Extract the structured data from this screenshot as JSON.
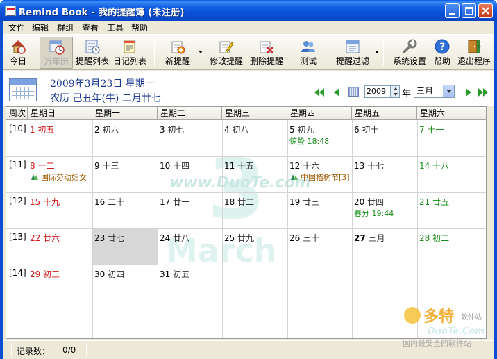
{
  "window": {
    "title": "Remind Book - 我的提醒簿 (未注册)"
  },
  "menu": [
    "文件",
    "编辑",
    "群组",
    "查看",
    "工具",
    "帮助"
  ],
  "toolbar": {
    "today": "今日",
    "year_calendar": "万年历",
    "reminder_list": "提醒列表",
    "diary_list": "日记列表",
    "new_reminder": "新提醒",
    "edit_reminder": "修改提醒",
    "delete_reminder": "删除提醒",
    "test": "测试",
    "reminder_filter": "提醒过滤",
    "system_settings": "系统设置",
    "help": "帮助",
    "exit": "退出程序"
  },
  "header": {
    "gregorian_date": "2009年3月23日 星期一",
    "lunar_date": "农历 己丑年(牛) 二月廿七",
    "year_value": "2009",
    "year_unit": "年",
    "month_value": "三月"
  },
  "calendar": {
    "columns": [
      "周次",
      "星期日",
      "星期一",
      "星期二",
      "星期三",
      "星期四",
      "星期五",
      "星期六"
    ],
    "weeks": [
      {
        "label": "[10]",
        "days": [
          {
            "num": "1",
            "lunar": "初五"
          },
          {
            "num": "2",
            "lunar": "初六"
          },
          {
            "num": "3",
            "lunar": "初七"
          },
          {
            "num": "4",
            "lunar": "初八"
          },
          {
            "num": "5",
            "lunar": "初九",
            "term": "惊蛰 18:48"
          },
          {
            "num": "6",
            "lunar": "初十"
          },
          {
            "num": "7",
            "lunar": "十一"
          }
        ]
      },
      {
        "label": "[11]",
        "days": [
          {
            "num": "8",
            "lunar": "十二",
            "event": "国际劳动妇女"
          },
          {
            "num": "9",
            "lunar": "十三"
          },
          {
            "num": "10",
            "lunar": "十四"
          },
          {
            "num": "11",
            "lunar": "十五"
          },
          {
            "num": "12",
            "lunar": "十六",
            "event": "中国植树节[3]"
          },
          {
            "num": "13",
            "lunar": "十七"
          },
          {
            "num": "14",
            "lunar": "十八"
          }
        ]
      },
      {
        "label": "[12]",
        "days": [
          {
            "num": "15",
            "lunar": "十九"
          },
          {
            "num": "16",
            "lunar": "二十"
          },
          {
            "num": "17",
            "lunar": "廿一"
          },
          {
            "num": "18",
            "lunar": "廿二"
          },
          {
            "num": "19",
            "lunar": "廿三"
          },
          {
            "num": "20",
            "lunar": "廿四",
            "term": "春分 19:44"
          },
          {
            "num": "21",
            "lunar": "廿五"
          }
        ]
      },
      {
        "label": "[13]",
        "days": [
          {
            "num": "22",
            "lunar": "廿六"
          },
          {
            "num": "23",
            "lunar": "廿七"
          },
          {
            "num": "24",
            "lunar": "廿八"
          },
          {
            "num": "25",
            "lunar": "廿九"
          },
          {
            "num": "26",
            "lunar": "三十"
          },
          {
            "num": "27",
            "lunar": "三月"
          },
          {
            "num": "28",
            "lunar": "初二"
          }
        ]
      },
      {
        "label": "[14]",
        "days": [
          {
            "num": "29",
            "lunar": "初三"
          },
          {
            "num": "30",
            "lunar": "初四"
          },
          {
            "num": "31",
            "lunar": "初五"
          },
          {
            "num": "",
            "lunar": ""
          },
          {
            "num": "",
            "lunar": ""
          },
          {
            "num": "",
            "lunar": ""
          },
          {
            "num": "",
            "lunar": ""
          }
        ]
      }
    ],
    "watermark": {
      "number": "3",
      "word": "March",
      "site": "www.DuoTe.com"
    }
  },
  "status": {
    "label": "记录数：",
    "value": "0/0"
  },
  "corner_watermark": {
    "brand": "多特",
    "brand_sub": "软件站",
    "site": "DuoTe.Com",
    "slogan": "国内最安全的软件站"
  },
  "colors": {
    "titlebar": "#0a52d8",
    "sunday": "#d01b1b",
    "saturday": "#1a8f1a",
    "header_text": "#1d3a93"
  }
}
